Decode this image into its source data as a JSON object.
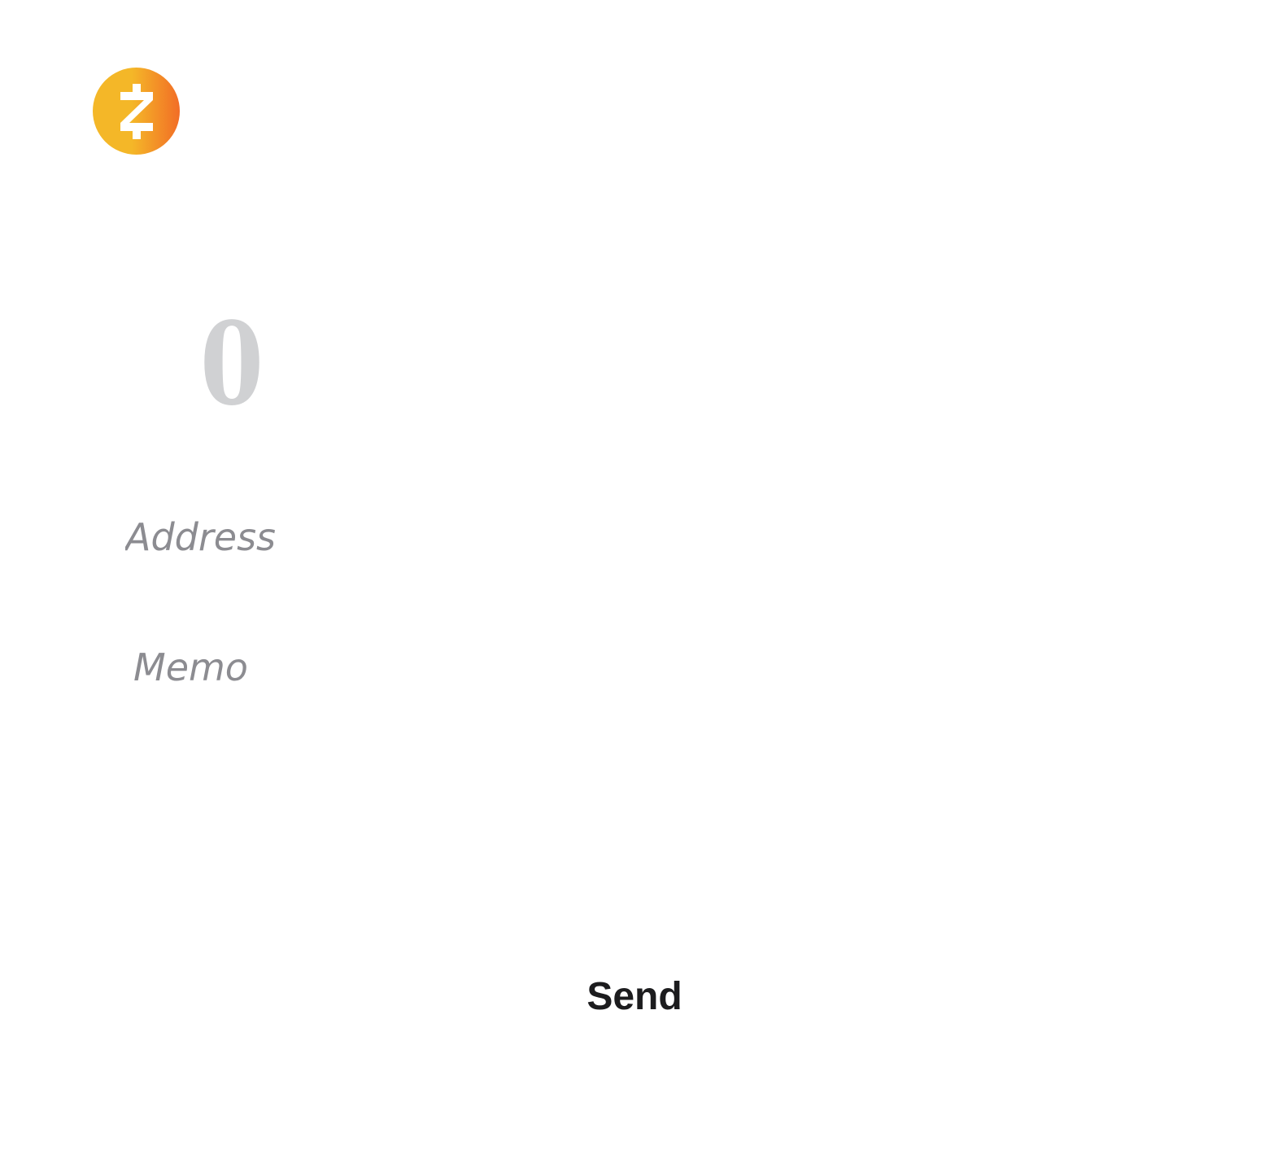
{
  "app": {
    "logo_icon": "zcash-logo-icon",
    "brand_colors": {
      "logo_gradient_start": "#F4B728",
      "logo_gradient_end": "#F26D26"
    }
  },
  "send_form": {
    "amount_value": "0",
    "address_placeholder": "Address",
    "memo_placeholder": "Memo",
    "send_label": "Send"
  },
  "colors": {
    "amount_text": "#D0D1D3",
    "placeholder_text": "#8C8C91",
    "button_text": "#1c1c1e",
    "background": "#ffffff"
  }
}
